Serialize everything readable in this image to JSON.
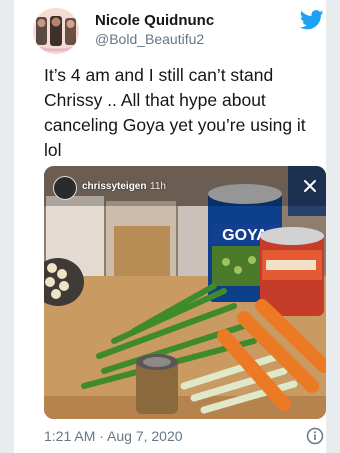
{
  "author": {
    "name": "Nicole Quidnunc",
    "handle": "@Bold_Beautifu2"
  },
  "tweet": {
    "text": "It’s 4 am and I still can’t stand Chrissy .. All that hype about canceling Goya yet you’re using it lol"
  },
  "story": {
    "username": "chrissyteigen",
    "time_ago": "11h",
    "can_label": "GOYA"
  },
  "footer": {
    "timestamp": "1:21 AM · Aug 7, 2020"
  },
  "icons": {
    "brand": "twitter-bird-icon",
    "info": "info-icon",
    "close": "close-icon"
  },
  "colors": {
    "twitter_blue": "#1da1f2",
    "text_primary": "#14171a",
    "text_secondary": "#657786"
  }
}
